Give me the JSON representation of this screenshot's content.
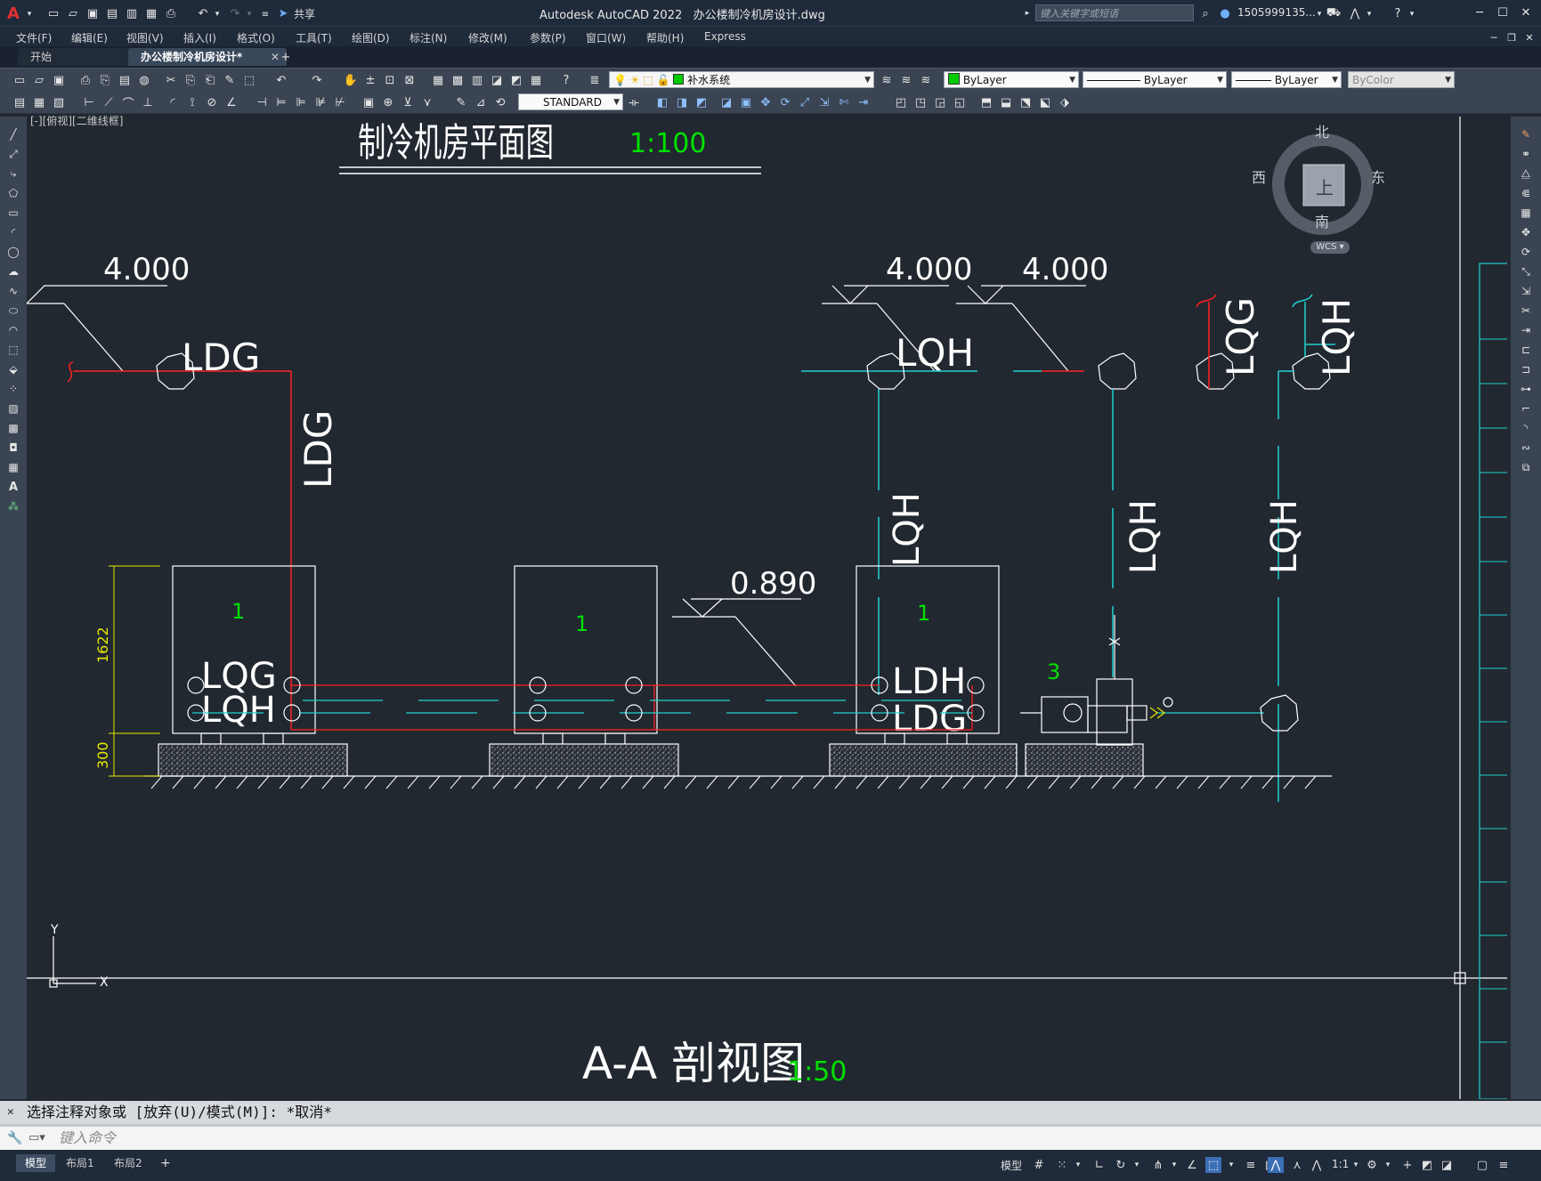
{
  "window": {
    "app_title": "Autodesk AutoCAD 2022",
    "file_title": "办公楼制冷机房设计.dwg",
    "search_placeholder": "键入关键字或短语",
    "user": "1505999135...",
    "share_label": "共享"
  },
  "menu": [
    "文件(F)",
    "编辑(E)",
    "视图(V)",
    "插入(I)",
    "格式(O)",
    "工具(T)",
    "绘图(D)",
    "标注(N)",
    "修改(M)",
    "参数(P)",
    "窗口(W)",
    "帮助(H)",
    "Express"
  ],
  "tabs": [
    {
      "label": "开始"
    },
    {
      "label": "办公楼制冷机房设计*",
      "active": true
    }
  ],
  "toolbar": {
    "layer": "补水系统",
    "layer_color": "#00cc00",
    "color": "ByLayer",
    "linetype": "ByLayer",
    "lineweight": "ByLayer",
    "plotstyle": "ByColor",
    "textstyle": "STANDARD"
  },
  "viewport_label": "[-][俯视][二维线框]",
  "viewcube": {
    "north": "北",
    "south": "南",
    "east": "东",
    "west": "西",
    "top": "上",
    "wcs": "WCS"
  },
  "drawing": {
    "title_plan": "制冷机房平面图",
    "scale_plan": "1:100",
    "title_section": "A-A 剖视图",
    "scale_section": "1:50",
    "elev_left": "4.000",
    "elev_mid1": "4.000",
    "elev_mid2": "4.000",
    "elev_low": "0.890",
    "label_ldg": "LDG",
    "label_lqh": "LQH",
    "label_lqg": "LQG",
    "label_ldh": "LDH",
    "unit1": "1",
    "unit3": "3",
    "dim_height": "1622",
    "dim_base": "300",
    "ucs_y": "Y",
    "ucs_x": "X"
  },
  "command": {
    "history": "选择注释对象或 [放弃(U)/模式(M)]: *取消*",
    "placeholder": "键入命令"
  },
  "status": {
    "layout_tabs": [
      "模型",
      "布局1",
      "布局2"
    ],
    "model_label": "模型",
    "scale": "1:1"
  }
}
